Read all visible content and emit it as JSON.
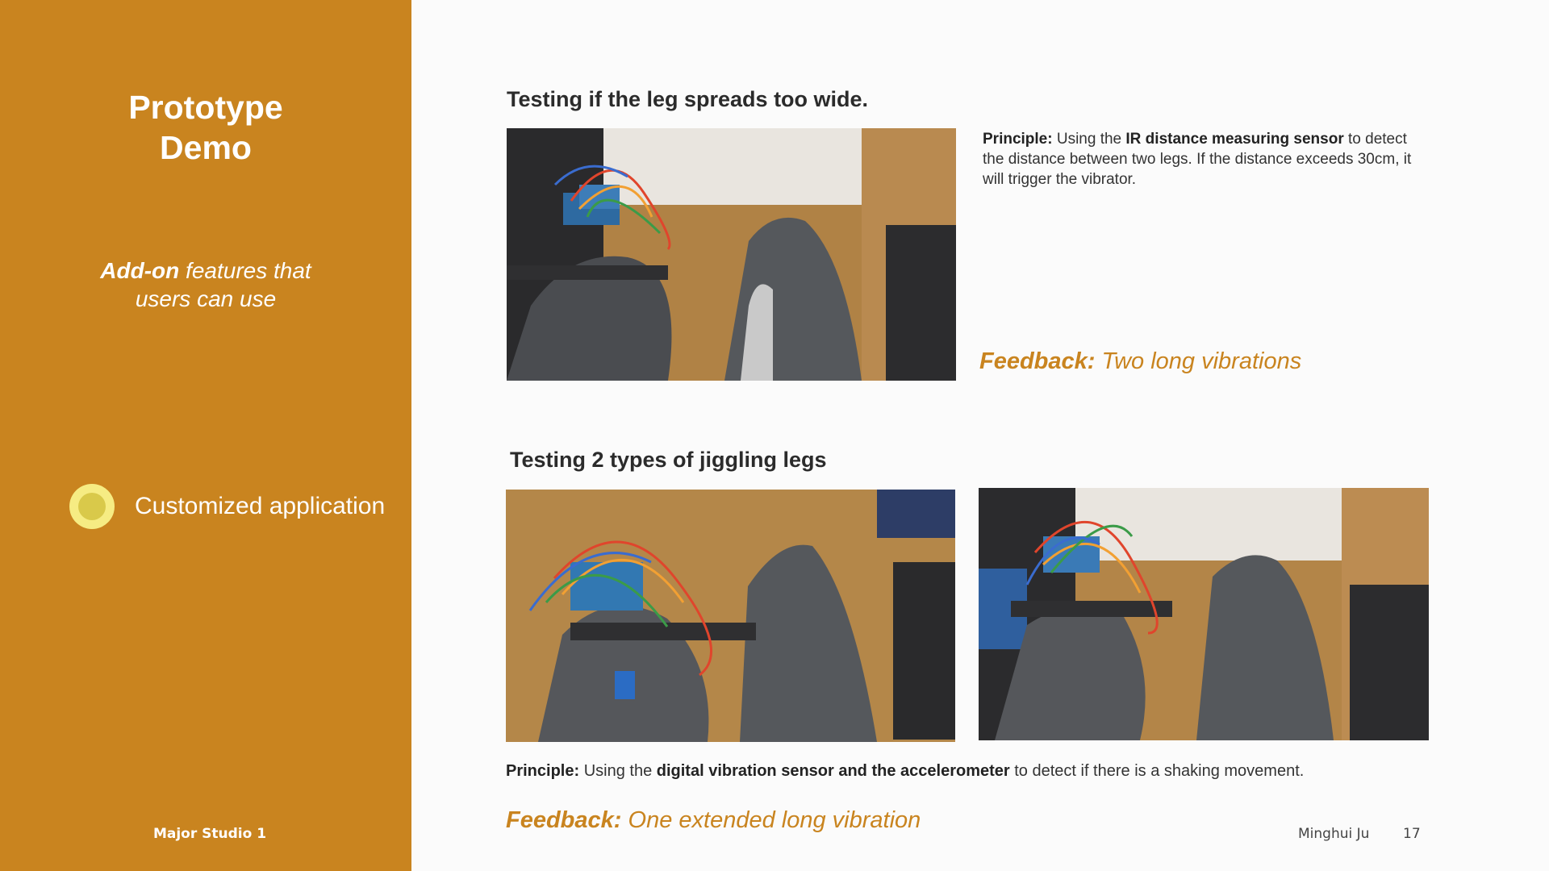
{
  "sidebar": {
    "title_line1": "Prototype",
    "title_line2": "Demo",
    "subtitle_bold": "Add-on",
    "subtitle_rest1": " features that",
    "subtitle_line2": "users can use",
    "bullet_label": "Customized application",
    "footer": "Major Studio 1"
  },
  "section1": {
    "heading": "Testing if the leg spreads too wide.",
    "principle_label": "Principle:",
    "principle_pre": " Using the ",
    "principle_bold": "IR distance measuring sensor",
    "principle_post": " to detect the distance between two legs. If the distance exceeds 30cm, it will trigger the vibrator.",
    "feedback_label": "Feedback:",
    "feedback_text": " Two long vibrations"
  },
  "section2": {
    "heading": "Testing 2 types of jiggling legs",
    "principle_label": "Principle:",
    "principle_pre": " Using the ",
    "principle_bold": "digital vibration sensor and the accelerometer",
    "principle_post": " to detect if there is a shaking movement.",
    "feedback_label": "Feedback:",
    "feedback_text": " One extended long vibration"
  },
  "footer": {
    "author": "Minghui Ju",
    "page_number": "17"
  },
  "colors": {
    "accent": "#c9841f",
    "bullet_outer": "#f6ec83",
    "bullet_inner": "#d9c94a"
  }
}
